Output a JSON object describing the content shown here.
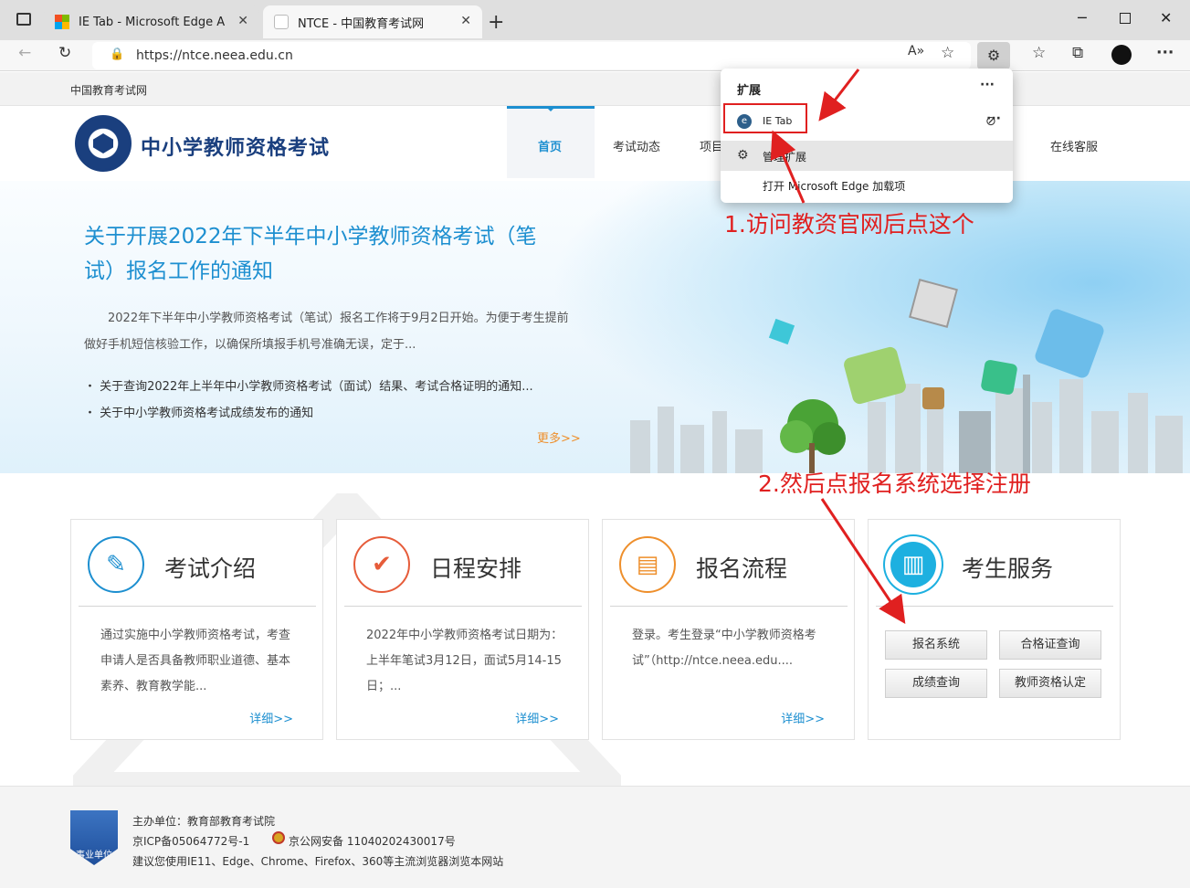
{
  "browser": {
    "tabs": [
      {
        "label": "IE Tab - Microsoft Edge Addons"
      },
      {
        "label": "NTCE - 中国教育考试网"
      }
    ],
    "url": "https://ntce.neea.edu.cn"
  },
  "extensions_popup": {
    "title": "扩展",
    "item": "IE Tab",
    "manage": "管理扩展",
    "open_addons": "打开 Microsoft Edge 加载项"
  },
  "site": {
    "top_link": "中国教育考试网",
    "name": "中小学教师资格考试",
    "nav": [
      "首页",
      "考试动态",
      "项目",
      "在线客服"
    ]
  },
  "banner": {
    "headline": "关于开展2022年下半年中小学教师资格考试（笔试）报名工作的通知",
    "intro": "2022年下半年中小学教师资格考试（笔试）报名工作将于9月2日开始。为便于考生提前做好手机短信核验工作，以确保所填报手机号准确无误，定于...",
    "bullets": [
      "关于查询2022年上半年中小学教师资格考试（面试）结果、考试合格证明的通知...",
      "关于中小学教师资格考试成绩发布的通知"
    ],
    "more": "更多>>"
  },
  "cards": [
    {
      "title": "考试介绍",
      "body": "通过实施中小学教师资格考试，考查申请人是否具备教师职业道德、基本素养、教育教学能...",
      "more": "详细>>"
    },
    {
      "title": "日程安排",
      "body": "2022年中小学教师资格考试日期为：上半年笔试3月12日，面试5月14-15日；...",
      "more": "详细>>"
    },
    {
      "title": "报名流程",
      "body": "登录。考生登录“中小学教师资格考试”（http://ntce.neea.edu....",
      "more": "详细>>"
    },
    {
      "title": "考生服务"
    }
  ],
  "services": [
    "报名系统",
    "合格证查询",
    "成绩查询",
    "教师资格认定"
  ],
  "footer": {
    "badge": "事业单位",
    "host": "主办单位：教育部教育考试院",
    "icp": "京ICP备05064772号-1",
    "police": "京公网安备 11040202430017号",
    "advice": "建议您使用IE11、Edge、Chrome、Firefox、360等主流浏览器浏览本网站"
  },
  "annotations": {
    "step1": "1.访问教资官网后点这个",
    "step2": "2.然后点报名系统选择注册"
  },
  "colors": {
    "accent": "#1d8fd0",
    "brand": "#1a3f7e",
    "annotation": "#e02020",
    "more": "#ee8f2c"
  }
}
